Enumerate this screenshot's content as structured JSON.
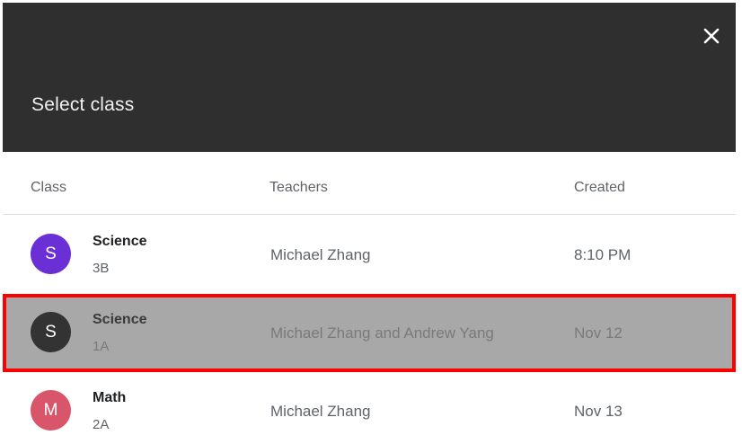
{
  "dialog": {
    "title": "Select class",
    "close_icon": "close-icon"
  },
  "columns": {
    "class": "Class",
    "teachers": "Teachers",
    "created": "Created"
  },
  "rows": [
    {
      "avatar_letter": "S",
      "avatar_color": "#6b2fd6",
      "name": "Science",
      "section": "3B",
      "teachers": "Michael Zhang",
      "created": "8:10 PM",
      "selected": false
    },
    {
      "avatar_letter": "S",
      "avatar_color": "#333333",
      "name": "Science",
      "section": "1A",
      "teachers": "Michael Zhang and Andrew Yang",
      "created": "Nov 12",
      "selected": true
    },
    {
      "avatar_letter": "M",
      "avatar_color": "#d9566a",
      "name": "Math",
      "section": "2A",
      "teachers": "Michael Zhang",
      "created": "Nov 13",
      "selected": false
    }
  ],
  "colors": {
    "header_bg": "#2f2f2f",
    "selection_outline": "#ff0000",
    "selection_fill": "#a8a8a8"
  }
}
